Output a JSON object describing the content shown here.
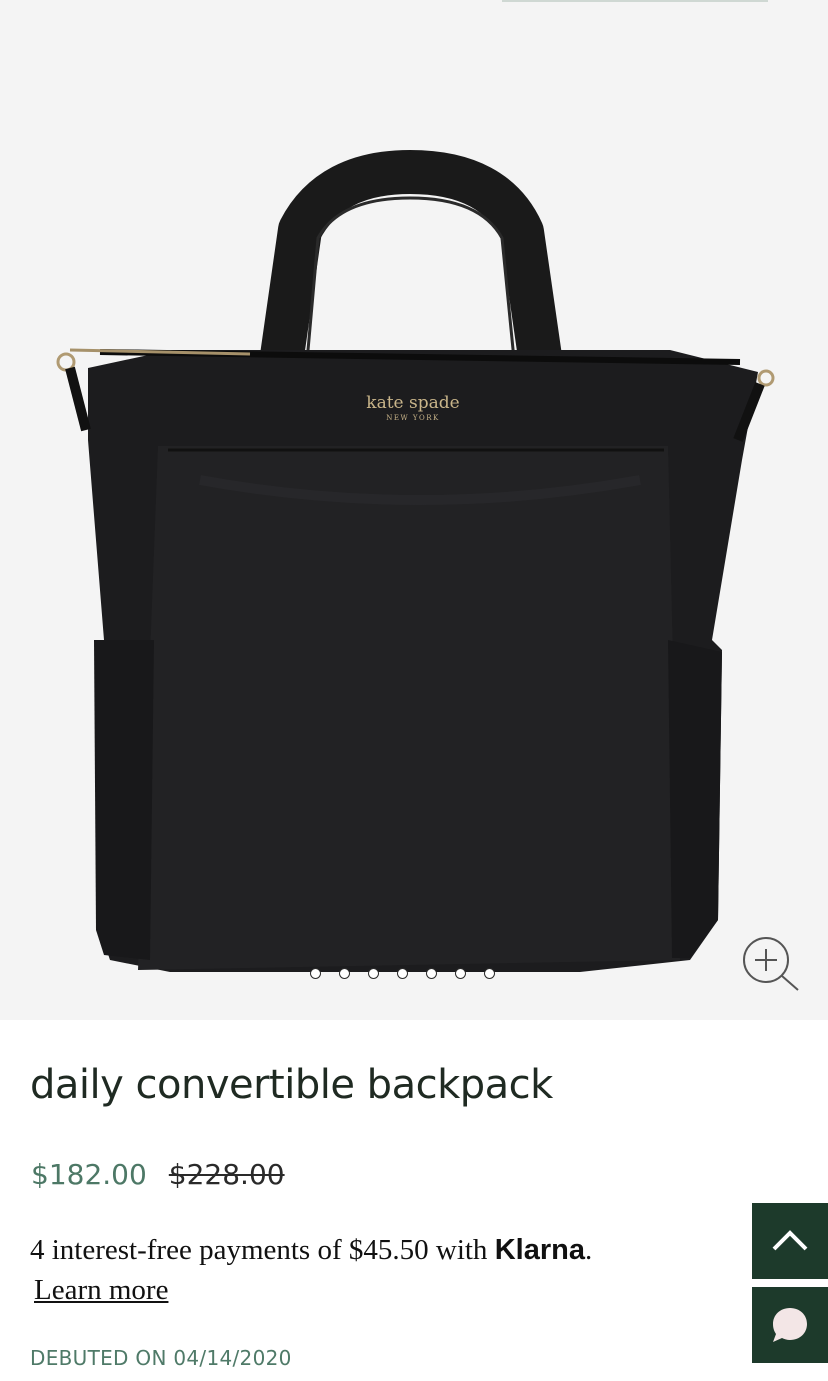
{
  "product": {
    "title": "daily convertible backpack",
    "sale_price": "$182.00",
    "original_price": "$228.00",
    "image_alt": "black nylon kate spade convertible backpack",
    "logo_text": "kate spade",
    "logo_subtext": "NEW YORK",
    "gallery": {
      "image_count": 7,
      "active_index": 0
    },
    "debuted": "DEBUTED ON 04/14/2020"
  },
  "klarna": {
    "text": "4 interest-free payments of $45.50 with ",
    "brand": "Klarna",
    "period": ".",
    "learn_more": "Learn more"
  },
  "icons": {
    "zoom": "zoom-in-icon",
    "back_to_top": "chevron-up-icon",
    "chat": "chat-bubble-icon"
  },
  "colors": {
    "accent_green": "#1d3a2b",
    "price_green": "#4d7866",
    "hero_bg": "#f4f4f4"
  }
}
